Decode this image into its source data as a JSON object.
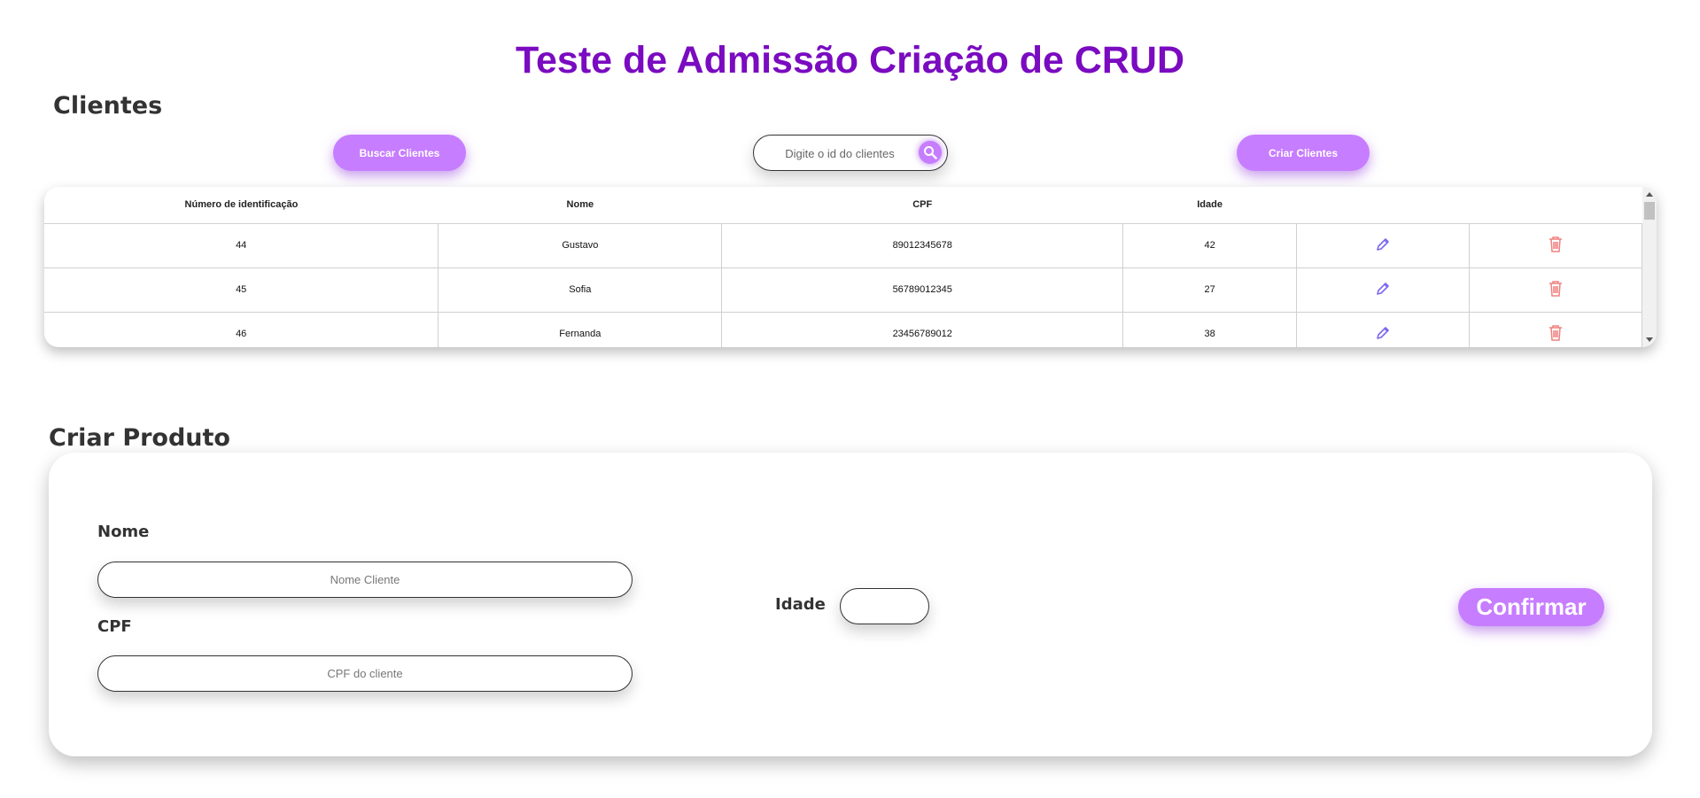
{
  "page_title": "Teste de Admissão Criação de CRUD",
  "clientes": {
    "title": "Clientes",
    "buscar_label": "Buscar Clientes",
    "criar_label": "Criar Clientes",
    "search_placeholder": "Digite o id do clientes",
    "columns": [
      "Número de identificação",
      "Nome",
      "CPF",
      "Idade"
    ],
    "rows": [
      {
        "id": "44",
        "nome": "Gustavo",
        "cpf": "89012345678",
        "idade": "42"
      },
      {
        "id": "45",
        "nome": "Sofia",
        "cpf": "56789012345",
        "idade": "27"
      },
      {
        "id": "46",
        "nome": "Fernanda",
        "cpf": "23456789012",
        "idade": "38"
      }
    ]
  },
  "criar_produto": {
    "title": "Criar Produto",
    "nome_label": "Nome",
    "nome_placeholder": "Nome Cliente",
    "cpf_label": "CPF",
    "cpf_placeholder": "CPF do cliente",
    "idade_label": "Idade",
    "confirmar_label": "Confirmar"
  },
  "colors": {
    "title": "#7a0bc0",
    "accent": "#c77dff",
    "edit_icon": "#7b68ee",
    "delete_icon": "#f08080"
  },
  "icons": {
    "search": "search-icon",
    "edit": "pencil-icon",
    "delete": "trash-icon"
  }
}
